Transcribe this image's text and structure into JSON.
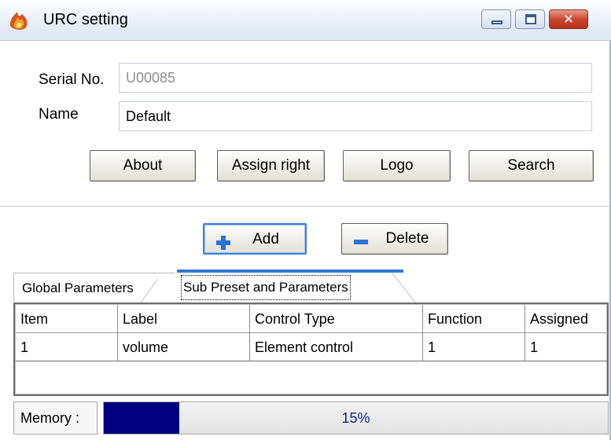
{
  "window": {
    "title": "URC setting",
    "close_glyph": "✕",
    "icon": "app-flame-icon"
  },
  "form": {
    "serial_label": "Serial No.",
    "serial_value": "U00085",
    "name_label": "Name",
    "name_value": "Default"
  },
  "buttons": {
    "about": "About",
    "assign_right": "Assign right",
    "logo": "Logo",
    "search": "Search",
    "add": "Add",
    "delete": "Delete"
  },
  "tabs": [
    {
      "label": "Global Parameters",
      "active": false
    },
    {
      "label": "Sub Preset and Parameters",
      "active": true
    }
  ],
  "table": {
    "columns": [
      "Item",
      "Label",
      "Control Type",
      "Function",
      "Assigned"
    ],
    "rows": [
      [
        "1",
        "volume",
        "Element control",
        "1",
        "1"
      ]
    ]
  },
  "status": {
    "memory_label": "Memory :",
    "memory_percent": 15,
    "memory_text": "15%"
  },
  "colors": {
    "progress_fill": "#00007f",
    "active_tab_accent": "#2e7ad1",
    "add_icon": "#2a72d4",
    "delete_icon": "#2a72d4"
  }
}
